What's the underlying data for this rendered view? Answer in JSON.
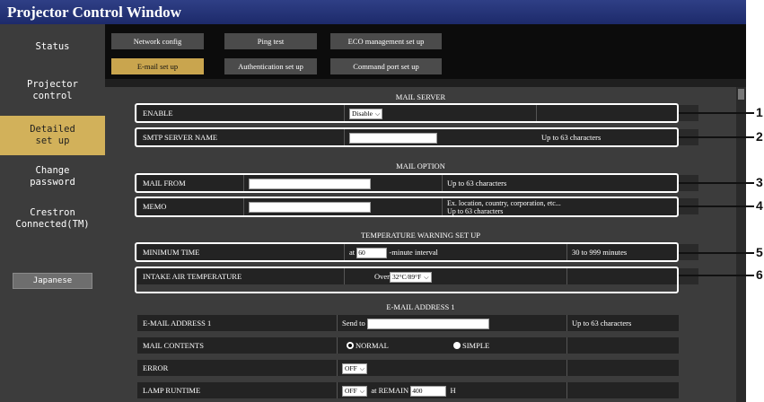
{
  "window": {
    "title": "Projector Control Window"
  },
  "sidebar": {
    "items": [
      {
        "label": "Status"
      },
      {
        "label": "Projector\ncontrol"
      },
      {
        "label": "Detailed\nset up"
      },
      {
        "label": "Change\npassword"
      },
      {
        "label": "Crestron\nConnected(TM)"
      }
    ],
    "language_button": "Japanese"
  },
  "tabs": [
    {
      "label": "Network config"
    },
    {
      "label": "Ping test"
    },
    {
      "label": "ECO management set up"
    },
    {
      "label": "E-mail set up"
    },
    {
      "label": "Authentication set up"
    },
    {
      "label": "Command port set up"
    }
  ],
  "mail_server": {
    "heading": "MAIL SERVER",
    "enable_label": "ENABLE",
    "enable_value": "Disable",
    "smtp_label": "SMTP SERVER NAME",
    "smtp_hint": "Up to 63 characters"
  },
  "mail_option": {
    "heading": "MAIL OPTION",
    "from_label": "MAIL FROM",
    "from_hint": "Up to 63 characters",
    "memo_label": "MEMO",
    "memo_hint_1": "Ex. location, country, corporation, etc...",
    "memo_hint_2": "Up to 63 characters"
  },
  "temperature": {
    "heading": "TEMPERATURE WARNING SET UP",
    "min_time_label": "MINIMUM TIME",
    "min_time_prefix": "at",
    "min_time_value": "60",
    "min_time_suffix": "-minute interval",
    "min_time_hint": "30 to 999 minutes",
    "intake_label": "INTAKE AIR TEMPERATURE",
    "intake_prefix": "Over",
    "intake_value": "32°C/89°F"
  },
  "email_address_1": {
    "heading": "E-MAIL ADDRESS 1",
    "address_label": "E-MAIL ADDRESS 1",
    "send_to": "Send to",
    "address_hint": "Up to 63 characters",
    "contents_label": "MAIL CONTENTS",
    "normal": "NORMAL",
    "simple": "SIMPLE",
    "error_label": "ERROR",
    "error_value": "OFF",
    "lamp_label": "LAMP RUNTIME",
    "lamp_value": "OFF",
    "lamp_remain": "at REMAIN",
    "lamp_hours": "400",
    "lamp_unit": "H"
  },
  "callouts": [
    "1",
    "2",
    "3",
    "4",
    "5",
    "6"
  ]
}
